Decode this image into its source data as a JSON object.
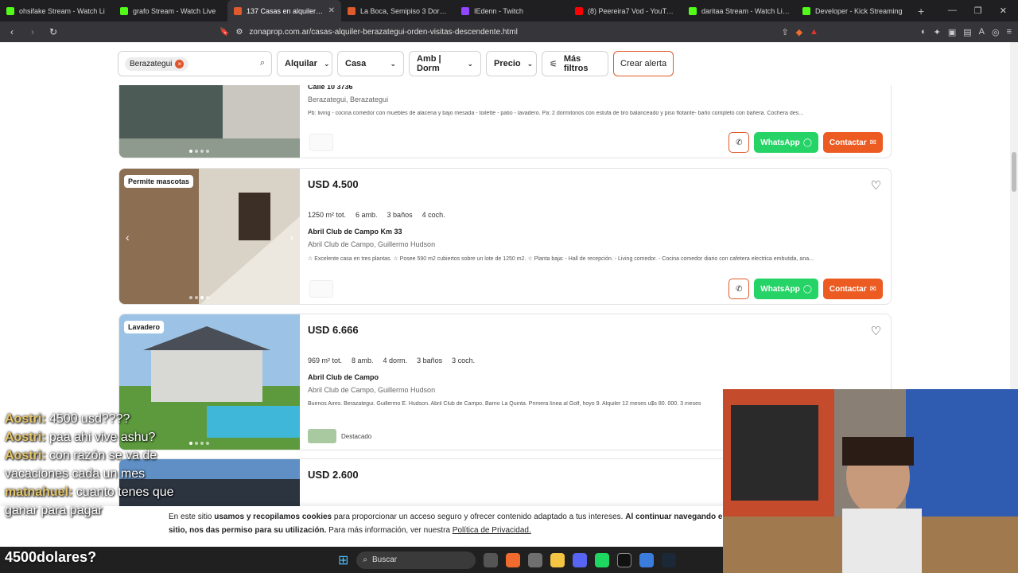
{
  "browser": {
    "tabs": [
      {
        "title": "ohsifake Stream - Watch Li",
        "color": "#53fc18",
        "active": false
      },
      {
        "title": "grafo Stream - Watch Live",
        "color": "#53fc18",
        "active": false
      },
      {
        "title": "137 Casas en alquiler en B",
        "color": "#e05a2b",
        "active": true
      },
      {
        "title": "La Boca, Semipiso 3 Dorm. Fre",
        "color": "#e05a2b",
        "active": false
      },
      {
        "title": "IEdenn - Twitch",
        "color": "#9146ff",
        "active": false
      },
      {
        "title": "(8) Peereira7 Vod - YouTube",
        "color": "#ff0000",
        "active": false
      },
      {
        "title": "daritaa Stream - Watch Live",
        "color": "#53fc18",
        "active": false
      },
      {
        "title": "Developer - Kick Streaming",
        "color": "#53fc18",
        "active": false
      }
    ],
    "url": "zonaprop.com.ar/casas-alquiler-berazategui-orden-visitas-descendente.html"
  },
  "filters": {
    "search_chip": "Berazategui",
    "operation": "Alquilar",
    "type": "Casa",
    "rooms": "Amb | Dorm",
    "price": "Precio",
    "more": "Más filtros",
    "alert": "Crear alerta"
  },
  "listings": [
    {
      "address": "Calle 10 3736",
      "location": "Berazategui, Berazategui",
      "description": "Pb: living - cocina comedor con muebles de alacena y bajo mesada - toilette - patio - lavadero. Pa: 2 dormitorios con estufa de tiro balanceado y piso flotante- baño completo con bañera. Cochera des...",
      "whatsapp": "WhatsApp",
      "contact": "Contactar"
    },
    {
      "badge": "Permite mascotas",
      "price": "USD 4.500",
      "features": [
        "1250 m² tot.",
        "6 amb.",
        "3 baños",
        "4 coch."
      ],
      "address": "Abril Club de Campo Km 33",
      "location": "Abril Club de Campo, Guillermo Hudson",
      "description": "☆ Excelente casa en tres plantas. ☆ Posee 590 m2 cubiertos sobre un lote de 1250 m2. ☆ Planta baja: - Hall de recepción. - Living comedor. - Cocina comedor diario con cafetera electrica embutida, ana...",
      "whatsapp": "WhatsApp",
      "contact": "Contactar"
    },
    {
      "badge": "Lavadero",
      "price": "USD 6.666",
      "features": [
        "969 m² tot.",
        "8 amb.",
        "4 dorm.",
        "3 baños",
        "3 coch."
      ],
      "address": "Abril Club de Campo",
      "location": "Abril Club de Campo, Guillermo Hudson",
      "description": "Buenos Aires. Berazategui. Guillermo E. Hudson. Abril Club de Campo. Barrio La Quinta. Primera línea al Golf, hoyo 9. Alquiler 12 meses u$s 80. 000. 3 meses",
      "highlight": "Destacado"
    },
    {
      "price": "USD 2.600"
    }
  ],
  "cookie": {
    "p1": "En este sitio ",
    "b1": "usamos y recopilamos cookies",
    "p2": " para proporcionar un acceso seguro y ofrecer contenido adaptado a tus intereses. ",
    "b2": "Al continuar navegando e",
    "b3": "sitio, nos das permiso para su utilización.",
    "p3": " Para más información, ver nuestra ",
    "link": "Política de Privacidad."
  },
  "chat": [
    {
      "user": "Aostri:",
      "msg": " 4500 usd????"
    },
    {
      "user": "Aostri:",
      "msg": " paa ahi vive ashu?"
    },
    {
      "user": "Aostri:",
      "msg": " con razón se va de vacaciones cada un mes"
    },
    {
      "user": "matnahuel:",
      "msg": " cuanto tenes que ganar para pagar"
    }
  ],
  "caption": "4500dolares?",
  "taskbar": {
    "search": "Buscar"
  }
}
